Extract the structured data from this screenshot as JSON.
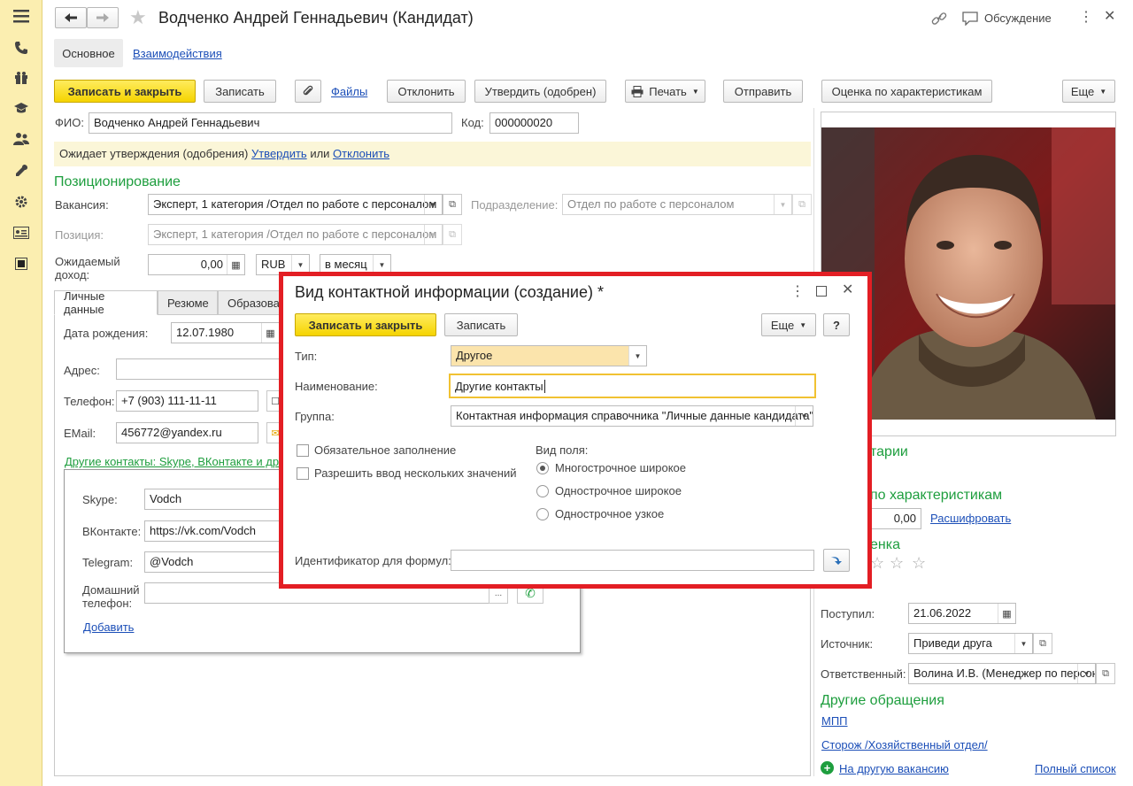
{
  "window": {
    "title": "Водченко Андрей Геннадьевич (Кандидат)",
    "discussion_label": "Обсуждение"
  },
  "nav_tabs": {
    "main": "Основное",
    "interactions": "Взаимодействия"
  },
  "toolbar": {
    "save_close": "Записать и закрыть",
    "save": "Записать",
    "files": "Файлы",
    "reject": "Отклонить",
    "approve": "Утвердить (одобрен)",
    "print": "Печать",
    "send": "Отправить",
    "evaluate": "Оценка по характеристикам",
    "more": "Еще"
  },
  "form": {
    "fio_label": "ФИО:",
    "fio_value": "Водченко Андрей Геннадьевич",
    "code_label": "Код:",
    "code_value": "000000020",
    "notice_text": "Ожидает утверждения (одобрения)",
    "notice_approve": "Утвердить",
    "notice_or": "или",
    "notice_reject": "Отклонить",
    "positioning_title": "Позиционирование",
    "vacancy_label": "Вакансия:",
    "vacancy_value": "Эксперт, 1 категория /Отдел по работе с персоналом",
    "division_label": "Подразделение:",
    "division_value": "Отдел по работе с персоналом",
    "position_label": "Позиция:",
    "position_value": "Эксперт, 1 категория /Отдел по работе с персоналом",
    "income_label_1": "Ожидаемый",
    "income_label_2": "доход:",
    "income_value": "0,00",
    "currency": "RUB",
    "period": "в месяц"
  },
  "inner_tabs": {
    "personal": "Личные данные",
    "resume": "Резюме",
    "education": "Образова"
  },
  "personal": {
    "birth_label": "Дата рождения:",
    "birth_value": "12.07.1980",
    "address_label": "Адрес:",
    "phone_label": "Телефон:",
    "phone_value": "+7 (903) 111-11-11",
    "email_label": "EMail:",
    "email_value": "456772@yandex.ru",
    "other_contacts_link": "Другие контакты: Skype, ВКонтакте и др",
    "skype_label": "Skype:",
    "skype_value": "Vodch",
    "vk_label": "ВКонтакте:",
    "vk_value": "https://vk.com/Vodch",
    "telegram_label": "Telegram:",
    "telegram_value": "@Vodch",
    "home_phone_label_1": "Домашний",
    "home_phone_label_2": "телефон:",
    "add_link": "Добавить"
  },
  "right_panel": {
    "comments_title": "тарии",
    "evaluation_title": "по характеристикам",
    "evaluation_value": "0,00",
    "decode_link": "Расшифровать",
    "rating_title": "енка",
    "received_label": "Поступил:",
    "received_value": "21.06.2022",
    "source_label": "Источник:",
    "source_value": "Приведи друга",
    "responsible_label": "Ответственный:",
    "responsible_value": "Волина И.В. (Менеджер по персоналу)",
    "other_requests_title": "Другие обращения",
    "mpp_link": "МПП",
    "guard_link": "Сторож /Хозяйственный отдел/",
    "another_vacancy_link": "На другую вакансию",
    "full_list_link": "Полный список"
  },
  "dialog": {
    "title": "Вид контактной информации (создание) *",
    "save_close": "Записать и закрыть",
    "save": "Записать",
    "more": "Еще",
    "help": "?",
    "type_label": "Тип:",
    "type_value": "Другое",
    "name_label": "Наименование:",
    "name_value": "Другие контакты",
    "group_label": "Группа:",
    "group_value": "Контактная информация справочника \"Личные данные кандидата\"",
    "required_label": "Обязательное заполнение",
    "multiple_label": "Разрешить ввод нескольких значений",
    "field_kind_label": "Вид поля:",
    "radio_options": [
      "Многострочное широкое",
      "Однострочное широкое",
      "Однострочное узкое"
    ],
    "formula_id_label": "Идентификатор для формул:",
    "formula_id_value": ""
  },
  "colors": {
    "accent_yellow": "#f5d400",
    "highlight_red": "#e31e24",
    "section_green": "#1e9e3e",
    "link_blue": "#1c4fb8"
  }
}
